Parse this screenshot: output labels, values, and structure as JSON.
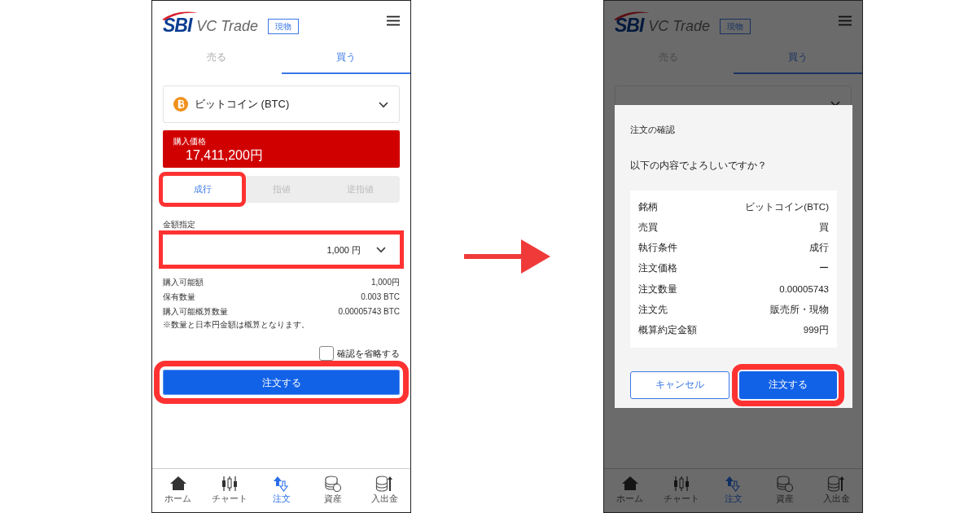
{
  "screens": [
    {
      "dimmed": false,
      "header": {
        "logo_mark": "SBI",
        "logo_text": "VC Trade",
        "badge": "現物"
      },
      "tabs": [
        {
          "label": "売る",
          "selected": false
        },
        {
          "label": "買う",
          "selected": true
        }
      ],
      "coin_select": {
        "value": "ビットコイン (BTC)"
      },
      "price": {
        "label": "購入価格",
        "value": "17,411,200円"
      },
      "order_types": [
        {
          "label": "成行",
          "selected": true,
          "highlighted": true
        },
        {
          "label": "指値",
          "selected": false,
          "highlighted": false
        },
        {
          "label": "逆指値",
          "selected": false,
          "highlighted": false
        }
      ],
      "amount": {
        "label": "金額指定",
        "value": "1,000 円",
        "highlighted": true
      },
      "info_rows": [
        {
          "label": "購入可能額",
          "value": "1,000円"
        },
        {
          "label": "保有数量",
          "value": "0.003 BTC"
        },
        {
          "label": "購入可能概算数量",
          "value": "0.00005743 BTC"
        }
      ],
      "note": "※数量と日本円金額は概算となります。",
      "skip_confirm": {
        "label": "確認を省略する",
        "checked": false
      },
      "submit": {
        "label": "注文する",
        "highlighted": true
      },
      "nav": [
        {
          "label": "ホーム",
          "selected": false
        },
        {
          "label": "チャート",
          "selected": false
        },
        {
          "label": "注文",
          "selected": true
        },
        {
          "label": "資産",
          "selected": false
        },
        {
          "label": "入出金",
          "selected": false
        }
      ]
    },
    {
      "dimmed": true,
      "header": {
        "logo_mark": "SBI",
        "logo_text": "VC Trade",
        "badge": "現物"
      },
      "tabs": [
        {
          "label": "売る",
          "selected": false
        },
        {
          "label": "買う",
          "selected": true
        }
      ],
      "nav": [
        {
          "label": "ホーム",
          "selected": false
        },
        {
          "label": "チャート",
          "selected": false
        },
        {
          "label": "注文",
          "selected": true
        },
        {
          "label": "資産",
          "selected": false
        },
        {
          "label": "入出金",
          "selected": false
        }
      ],
      "dialog": {
        "title": "注文の確認",
        "message": "以下の内容でよろしいですか？",
        "rows": [
          {
            "label": "銘柄",
            "value": "ビットコイン(BTC)"
          },
          {
            "label": "売買",
            "value": "買"
          },
          {
            "label": "執行条件",
            "value": "成行"
          },
          {
            "label": "注文価格",
            "value": "ー"
          },
          {
            "label": "注文数量",
            "value": "0.00005743"
          },
          {
            "label": "注文先",
            "value": "販売所・現物"
          },
          {
            "label": "概算約定金額",
            "value": "999円"
          }
        ],
        "buttons": [
          {
            "label": "キャンセル",
            "kind": "secondary",
            "highlighted": false
          },
          {
            "label": "注文する",
            "kind": "primary",
            "highlighted": true
          }
        ]
      }
    }
  ]
}
